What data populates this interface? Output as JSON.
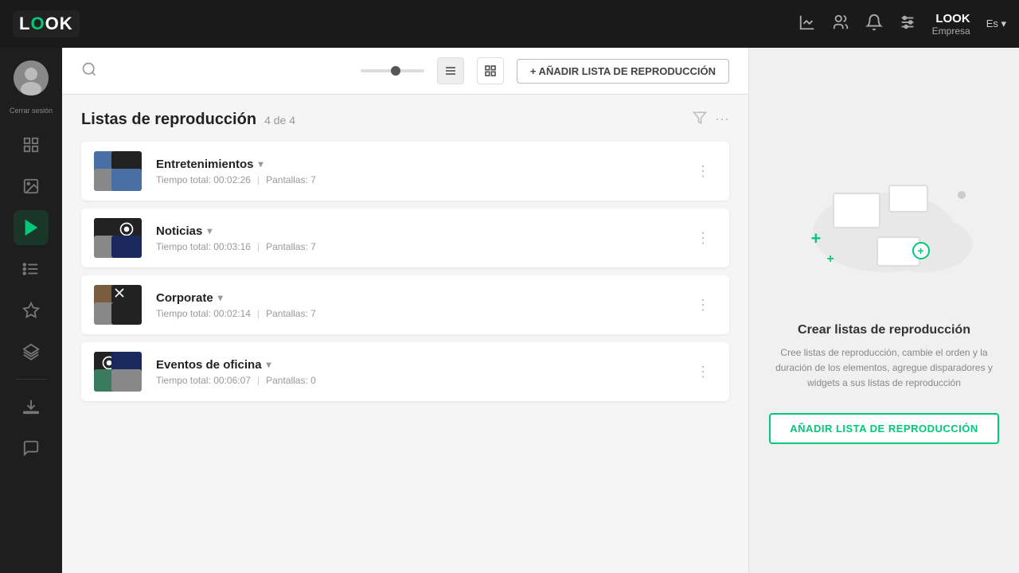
{
  "navbar": {
    "logo": "LOOK",
    "logo_o": "O",
    "company": "Empresa",
    "lang": "Es ▾",
    "icons": [
      "chart-icon",
      "users-icon",
      "bell-icon",
      "sliders-icon"
    ]
  },
  "sidebar": {
    "logout_label": "Cerrar sesión",
    "items": [
      {
        "id": "files-item",
        "icon": "files"
      },
      {
        "id": "image-item",
        "icon": "image"
      },
      {
        "id": "playlist-item",
        "icon": "playlist",
        "active": true
      },
      {
        "id": "list-item",
        "icon": "list"
      },
      {
        "id": "star-item",
        "icon": "star"
      },
      {
        "id": "layers-item",
        "icon": "layers"
      },
      {
        "id": "download-item",
        "icon": "download"
      },
      {
        "id": "chat-item",
        "icon": "chat"
      }
    ]
  },
  "toolbar": {
    "add_button_label": "+ AÑADIR LISTA DE REPRODUCCIÓN"
  },
  "section": {
    "title": "Listas de reproducción",
    "count": "4 de 4"
  },
  "playlists": [
    {
      "name": "Entretenimientos",
      "has_chevron": true,
      "total_time": "Tiempo total: 00:02:26",
      "screens": "Pantallas: 7",
      "thumb_colors": [
        "blue-thumb",
        "dark-thumb",
        "gray-thumb",
        "blue-thumb"
      ]
    },
    {
      "name": "Noticias",
      "has_chevron": true,
      "total_time": "Tiempo total: 00:03:16",
      "screens": "Pantallas: 7",
      "thumb_colors": [
        "dark-thumb",
        "music-thumb",
        "gray-thumb",
        "navy-thumb"
      ],
      "has_music": true
    },
    {
      "name": "Corporate",
      "has_chevron": true,
      "total_time": "Tiempo total: 00:02:14",
      "screens": "Pantallas: 7",
      "thumb_colors": [
        "brown-thumb",
        "dark-thumb",
        "gray-thumb",
        "dark-thumb"
      ]
    },
    {
      "name": "Eventos de oficina",
      "has_chevron": true,
      "total_time": "Tiempo total: 00:06:07",
      "screens": "Pantallas: 0",
      "thumb_colors": [
        "dark-thumb",
        "navy-thumb",
        "green-thumb",
        "gray-thumb"
      ],
      "has_music2": true
    }
  ],
  "right_panel": {
    "title": "Crear listas de reproducción",
    "description": "Cree listas de reproducción, cambie el orden y la duración de los elementos, agregue disparadores y widgets a sus listas de reproducción",
    "button_label": "AÑADIR LISTA DE REPRODUCCIÓN"
  }
}
